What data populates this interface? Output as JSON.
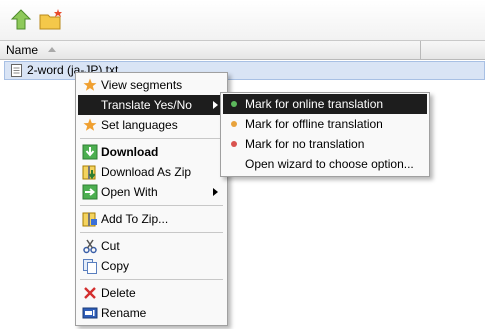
{
  "toolbar": {
    "buttons": [
      {
        "icon": "upload-arrow-icon",
        "color": "#7bc043"
      },
      {
        "icon": "new-folder-icon",
        "color": "#f0c33c"
      }
    ]
  },
  "list": {
    "column_name": "Name",
    "sort_icon": "sort-ascending-icon",
    "files": [
      {
        "name": "2-word (ja-JP).txt",
        "icon": "text-file-icon"
      }
    ]
  },
  "context_menu": {
    "groups": [
      [
        {
          "label": "View segments",
          "icon": "star-icon"
        },
        {
          "label": "Translate Yes/No",
          "icon": "",
          "submenu": true,
          "highlighted": true
        },
        {
          "label": "Set languages",
          "icon": "star-icon"
        }
      ],
      [
        {
          "label": "Download",
          "icon": "download-icon",
          "bold": true
        },
        {
          "label": "Download As Zip",
          "icon": "zip-download-icon"
        },
        {
          "label": "Open With",
          "icon": "open-with-icon",
          "submenu": true
        }
      ],
      [
        {
          "label": "Add To Zip...",
          "icon": "add-to-zip-icon"
        }
      ],
      [
        {
          "label": "Cut",
          "icon": "scissors-icon"
        },
        {
          "label": "Copy",
          "icon": "copy-icon"
        }
      ],
      [
        {
          "label": "Delete",
          "icon": "delete-x-icon"
        },
        {
          "label": "Rename",
          "icon": "rename-icon"
        }
      ]
    ]
  },
  "submenu": {
    "items": [
      {
        "label": "Mark for online translation",
        "dot_color": "#5cb85c",
        "highlighted": true
      },
      {
        "label": "Mark for offline translation",
        "dot_color": "#e8a33d"
      },
      {
        "label": "Mark for no translation",
        "dot_color": "#d9534f"
      },
      {
        "label": "Open wizard to choose option...",
        "dot_color": ""
      }
    ]
  },
  "colors": {
    "highlight": "#1d1d1d",
    "selection": "#d9e4f5",
    "star": "#f0a030"
  }
}
